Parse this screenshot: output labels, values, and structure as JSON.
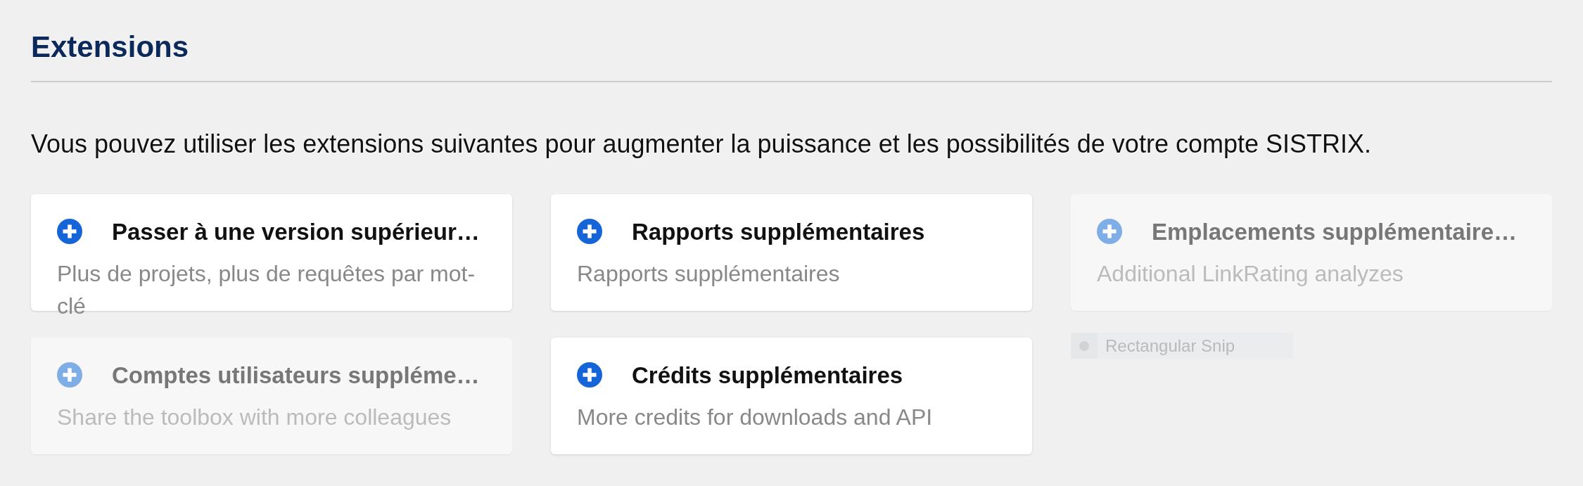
{
  "page": {
    "title": "Extensions"
  },
  "intro": "Vous pouvez utiliser les extensions suivantes pour augmenter la puissance et les possibilités de votre compte SISTRIX.",
  "extensions": [
    {
      "title": "Passer à une version supérieur…",
      "description": "Plus de projets, plus de requêtes par mot-clé",
      "disabled": false
    },
    {
      "title": "Rapports supplémentaires",
      "description": "Rapports supplémentaires",
      "disabled": false
    },
    {
      "title": "Emplacements supplémentaire…",
      "description": "Additional LinkRating analyzes",
      "disabled": true
    },
    {
      "title": "Comptes utilisateurs suppléme…",
      "description": "Share the toolbox with more colleagues",
      "disabled": true
    },
    {
      "title": "Crédits supplémentaires",
      "description": "More credits for downloads and API",
      "disabled": false
    }
  ],
  "snip_overlay": {
    "label": "Rectangular Snip"
  }
}
